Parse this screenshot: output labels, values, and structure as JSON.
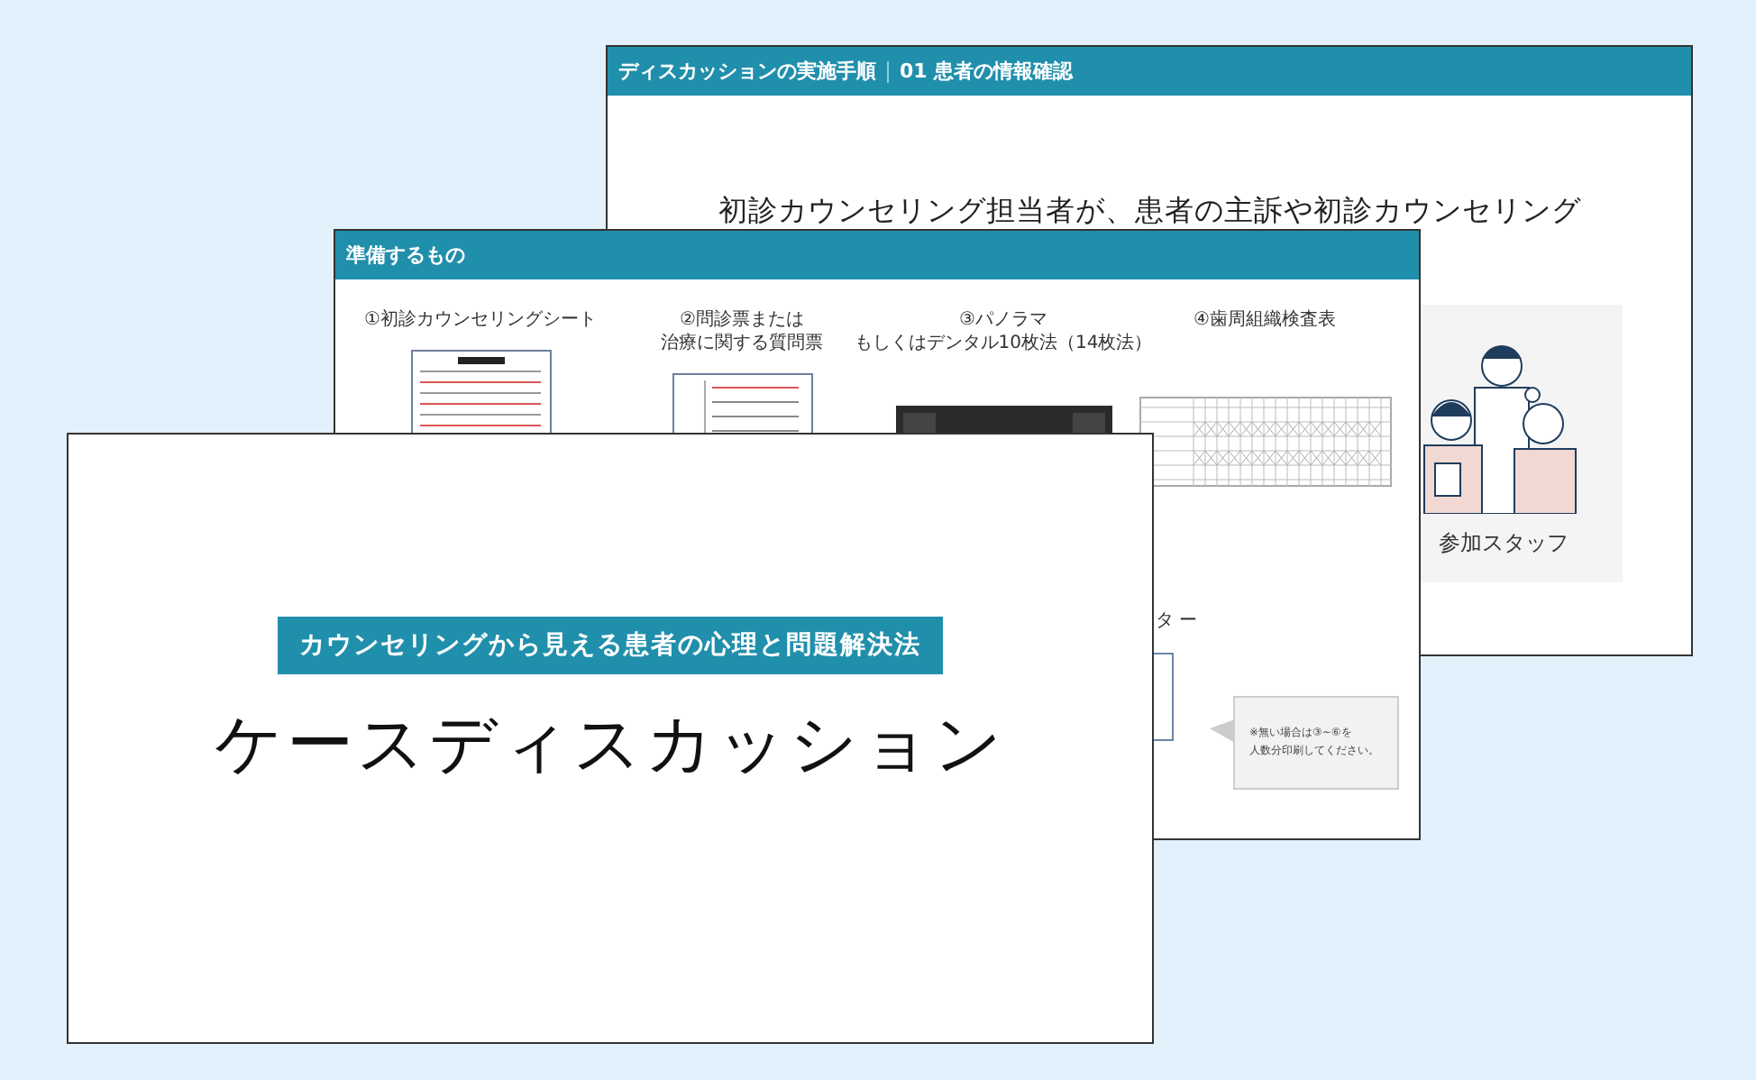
{
  "slides": [
    {
      "kind": "step",
      "header": [
        "ディスカッションの実施手順",
        "01 患者の情報確認"
      ],
      "body": "初診カウンセリング担当者が、患者の主訴や初診カウンセリング",
      "card": {
        "label": "参加スタッフ"
      }
    },
    {
      "kind": "materials",
      "header": "準備するもの",
      "items": [
        {
          "lines": [
            "①初診カウンセリングシート"
          ],
          "kind": "sheet"
        },
        {
          "lines": [
            "②問診票または",
            "治療に関する質問票"
          ],
          "kind": "form"
        },
        {
          "lines": [
            "③パノラマ",
            "もしくはデンタル10枚法（14枚法）"
          ],
          "kind": "xray"
        },
        {
          "lines": [
            "④歯周組織検査表"
          ],
          "kind": "table"
        }
      ],
      "partial_label": "タ ー",
      "note": [
        "※無い場合は③~⑥を",
        "人数分印刷してください。"
      ]
    },
    {
      "kind": "title",
      "badge": "カウンセリングから見える患者の心理と問題解決法",
      "title": "ケースディスカッション"
    }
  ]
}
